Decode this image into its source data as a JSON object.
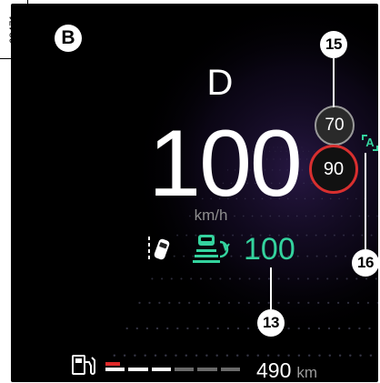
{
  "figure_ref": "63471",
  "panel_label": "B",
  "gear": "D",
  "speed": {
    "value": "100",
    "unit": "km/h"
  },
  "speed_limit": {
    "set_value": "70",
    "sign_value": "90",
    "auto_mode_label": "A"
  },
  "cruise": {
    "set_speed": "100"
  },
  "callouts": {
    "c15": "15",
    "c16": "16",
    "c13": "13"
  },
  "fuel": {
    "range_value": "490",
    "range_unit": "km",
    "level_fraction": 0.55
  },
  "colors": {
    "accent_green": "#34d39e",
    "limit_red": "#d82f2f",
    "fuel_low_red": "#e02a2a"
  }
}
